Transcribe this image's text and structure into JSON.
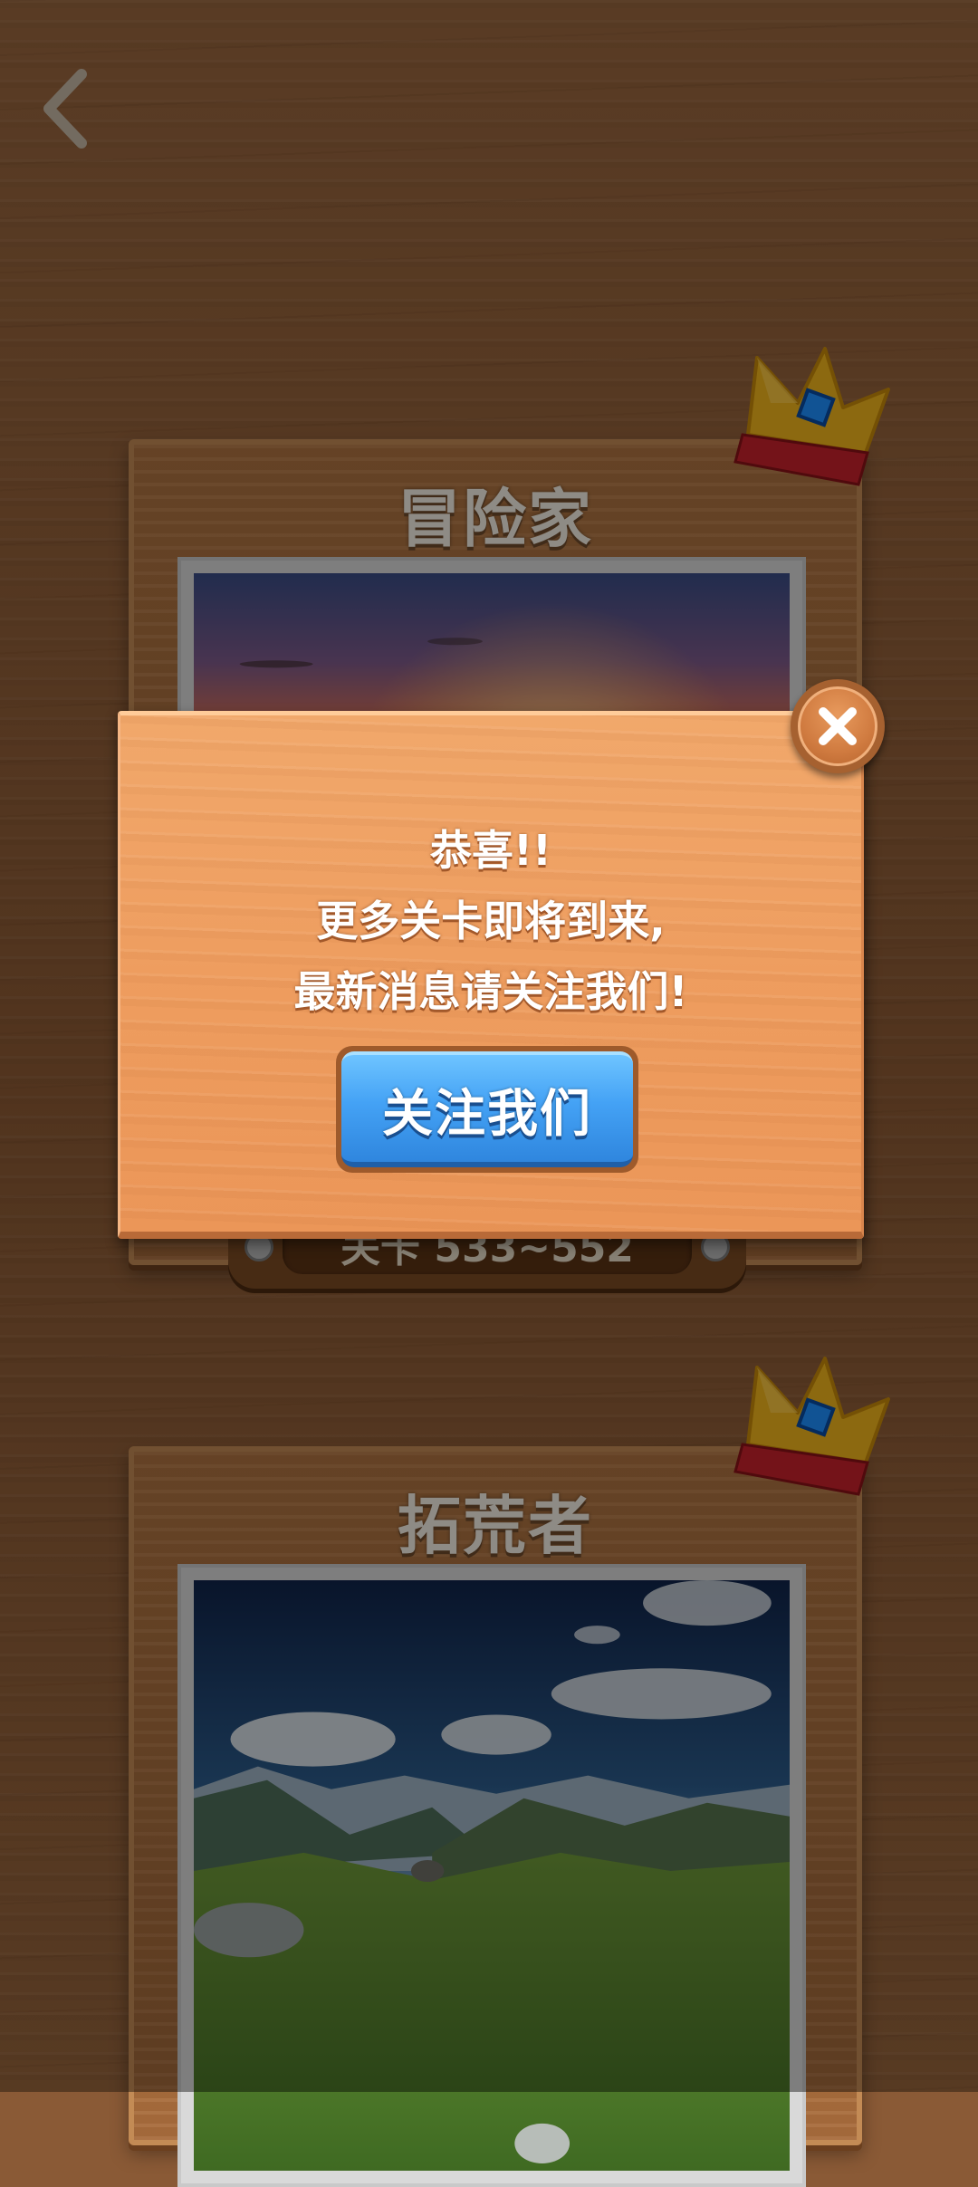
{
  "header": {
    "back_icon": "chevron-left-icon"
  },
  "cards": [
    {
      "title": "冒险家",
      "level_range": "关卡 533~552",
      "photo": "sunset-sky",
      "crown_icon": "crown-icon"
    },
    {
      "title": "拓荒者",
      "photo": "mountain-meadow",
      "crown_icon": "crown-icon"
    }
  ],
  "dialog": {
    "line1": "恭喜!!",
    "line2": "更多关卡即将到来,",
    "line3": "最新消息请关注我们!",
    "follow_button_label": "关注我们",
    "close_icon": "close-icon"
  },
  "colors": {
    "dialog_wood": "#ee9d5f",
    "button_blue": "#44a2f5",
    "card_wood": "#a86c3c",
    "crown_gold": "#f2b51c",
    "crown_red": "#c8222b",
    "gem_blue": "#1e90ff"
  }
}
